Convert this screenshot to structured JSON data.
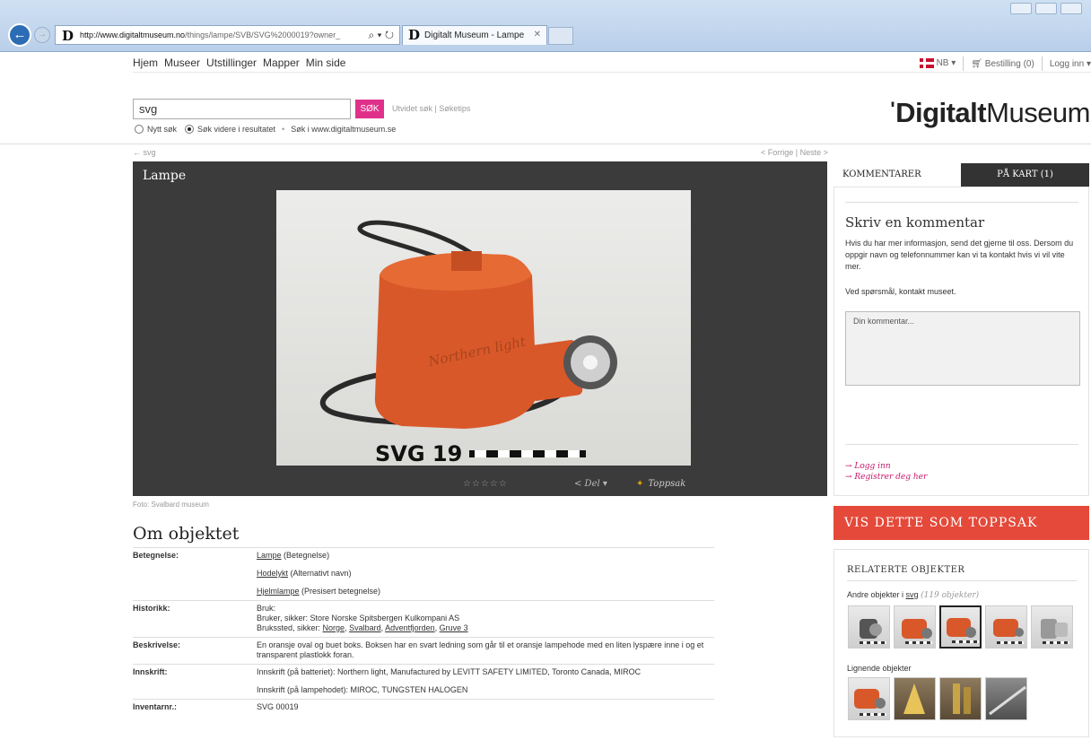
{
  "browser": {
    "url_host": "http://www.digitaltmuseum.no",
    "url_path": "/things/lampe/SVB/SVG%2000019?owner_",
    "tab_title": "Digitalt Museum - Lampe",
    "favicon": "D"
  },
  "topnav": [
    "Hjem",
    "Museer",
    "Utstillinger",
    "Mapper",
    "Min side"
  ],
  "topright": {
    "language": "NB",
    "order": "Bestilling (0)",
    "login": "Logg inn"
  },
  "search": {
    "value": "svg",
    "button": "SØK",
    "links": "Utvidet søk | Søketips",
    "opt_new": "Nytt søk",
    "opt_refine": "Søk videre i resultatet",
    "opt_se": "Søk i www.digitaltmuseum.se"
  },
  "logo": {
    "bold": "Digitalt",
    "light": "Museum"
  },
  "breadcrumb": "← svg",
  "prevnext": "< Forrige | Neste >",
  "viewer": {
    "title": "Lampe",
    "stars": "☆☆☆☆☆",
    "share": "< Del ▾",
    "toppsak": "Toppsak",
    "photo_label": "SVG 19",
    "lamp_text": "Northern light",
    "credit": "Foto: Svalbard museum"
  },
  "om": {
    "title": "Om objektet",
    "rows": [
      {
        "key": "Betegnelse:",
        "lines": [
          {
            "link": "Lampe",
            "text": " (Betegnelse)"
          },
          {
            "link": "Hodelykt",
            "text": " (Alternativt navn)"
          },
          {
            "link": "Hjelmlampe",
            "text": " (Presisert betegnelse)"
          }
        ]
      },
      {
        "key": "Historikk:",
        "lines": [
          {
            "text": "Bruk:"
          },
          {
            "text": "Bruker, sikker: Store Norske Spitsbergen Kulkompani AS"
          },
          {
            "text": "Brukssted, sikker: ",
            "links": [
              "Norge",
              "Svalbard",
              "Adventfjorden",
              "Gruve 3"
            ]
          }
        ]
      },
      {
        "key": "Beskrivelse:",
        "lines": [
          {
            "text": "En oransje oval og buet boks. Boksen har en svart ledning som går til et oransje lampehode med en liten lyspære inne i og et transparent plastlokk foran."
          }
        ]
      },
      {
        "key": "Innskrift:",
        "lines": [
          {
            "text": "Innskrift (på batteriet): Northern light, Manufactured by LEVITT SAFETY LIMITED, Toronto Canada, MIROC"
          },
          {
            "text": "Innskrift (på lampehodet): MIROC, TUNGSTEN HALOGEN"
          }
        ]
      },
      {
        "key": "Inventarnr.:",
        "lines": [
          {
            "text": "SVG 00019"
          }
        ]
      }
    ]
  },
  "tabs": {
    "comments": "KOMMENTARER",
    "map": "PÅ KART (1)"
  },
  "comments": {
    "heading": "Skriv en kommentar",
    "intro": "Hvis du har mer informasjon, send det gjerne til oss. Dersom du oppgir navn og telefonnummer kan vi ta kontakt hvis vi vil vite mer.",
    "contact": "Ved spørsmål, kontakt museet.",
    "placeholder": "Din kommentar...",
    "login": "→ Logg inn",
    "register": "→ Registrer deg her"
  },
  "toppsak_button": "VIS DETTE SOM TOPPSAK",
  "related": {
    "heading": "RELATERTE OBJEKTER",
    "others_prefix": "Andre objekter i ",
    "others_link": "svg",
    "others_count": "(119 objekter)",
    "similar": "Lignende objekter"
  },
  "colors": {
    "accent_pink": "#e0318a",
    "toppsak_red": "#e4493a",
    "lamp_orange": "#d9582a",
    "link_magenta": "#c3176b"
  }
}
